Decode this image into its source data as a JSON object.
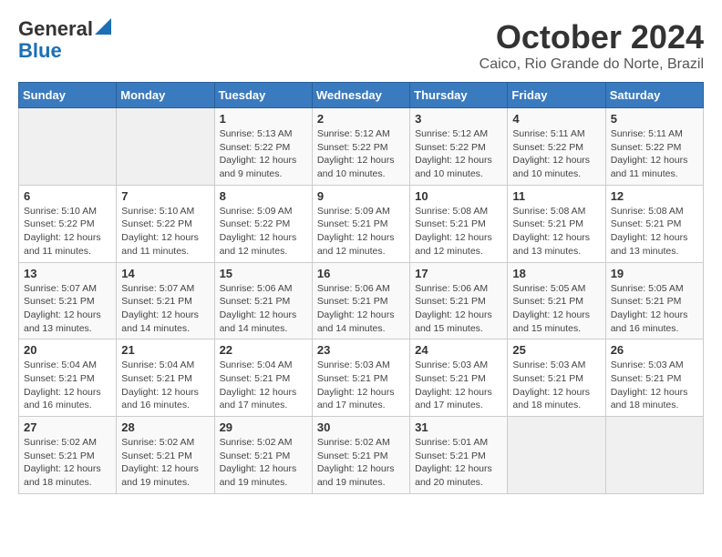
{
  "header": {
    "logo_line1": "General",
    "logo_line2": "Blue",
    "month": "October 2024",
    "location": "Caico, Rio Grande do Norte, Brazil"
  },
  "weekdays": [
    "Sunday",
    "Monday",
    "Tuesday",
    "Wednesday",
    "Thursday",
    "Friday",
    "Saturday"
  ],
  "weeks": [
    [
      {
        "day": null
      },
      {
        "day": null
      },
      {
        "day": "1",
        "sunrise": "5:13 AM",
        "sunset": "5:22 PM",
        "daylight": "12 hours and 9 minutes."
      },
      {
        "day": "2",
        "sunrise": "5:12 AM",
        "sunset": "5:22 PM",
        "daylight": "12 hours and 10 minutes."
      },
      {
        "day": "3",
        "sunrise": "5:12 AM",
        "sunset": "5:22 PM",
        "daylight": "12 hours and 10 minutes."
      },
      {
        "day": "4",
        "sunrise": "5:11 AM",
        "sunset": "5:22 PM",
        "daylight": "12 hours and 10 minutes."
      },
      {
        "day": "5",
        "sunrise": "5:11 AM",
        "sunset": "5:22 PM",
        "daylight": "12 hours and 11 minutes."
      }
    ],
    [
      {
        "day": "6",
        "sunrise": "5:10 AM",
        "sunset": "5:22 PM",
        "daylight": "12 hours and 11 minutes."
      },
      {
        "day": "7",
        "sunrise": "5:10 AM",
        "sunset": "5:22 PM",
        "daylight": "12 hours and 11 minutes."
      },
      {
        "day": "8",
        "sunrise": "5:09 AM",
        "sunset": "5:22 PM",
        "daylight": "12 hours and 12 minutes."
      },
      {
        "day": "9",
        "sunrise": "5:09 AM",
        "sunset": "5:21 PM",
        "daylight": "12 hours and 12 minutes."
      },
      {
        "day": "10",
        "sunrise": "5:08 AM",
        "sunset": "5:21 PM",
        "daylight": "12 hours and 12 minutes."
      },
      {
        "day": "11",
        "sunrise": "5:08 AM",
        "sunset": "5:21 PM",
        "daylight": "12 hours and 13 minutes."
      },
      {
        "day": "12",
        "sunrise": "5:08 AM",
        "sunset": "5:21 PM",
        "daylight": "12 hours and 13 minutes."
      }
    ],
    [
      {
        "day": "13",
        "sunrise": "5:07 AM",
        "sunset": "5:21 PM",
        "daylight": "12 hours and 13 minutes."
      },
      {
        "day": "14",
        "sunrise": "5:07 AM",
        "sunset": "5:21 PM",
        "daylight": "12 hours and 14 minutes."
      },
      {
        "day": "15",
        "sunrise": "5:06 AM",
        "sunset": "5:21 PM",
        "daylight": "12 hours and 14 minutes."
      },
      {
        "day": "16",
        "sunrise": "5:06 AM",
        "sunset": "5:21 PM",
        "daylight": "12 hours and 14 minutes."
      },
      {
        "day": "17",
        "sunrise": "5:06 AM",
        "sunset": "5:21 PM",
        "daylight": "12 hours and 15 minutes."
      },
      {
        "day": "18",
        "sunrise": "5:05 AM",
        "sunset": "5:21 PM",
        "daylight": "12 hours and 15 minutes."
      },
      {
        "day": "19",
        "sunrise": "5:05 AM",
        "sunset": "5:21 PM",
        "daylight": "12 hours and 16 minutes."
      }
    ],
    [
      {
        "day": "20",
        "sunrise": "5:04 AM",
        "sunset": "5:21 PM",
        "daylight": "12 hours and 16 minutes."
      },
      {
        "day": "21",
        "sunrise": "5:04 AM",
        "sunset": "5:21 PM",
        "daylight": "12 hours and 16 minutes."
      },
      {
        "day": "22",
        "sunrise": "5:04 AM",
        "sunset": "5:21 PM",
        "daylight": "12 hours and 17 minutes."
      },
      {
        "day": "23",
        "sunrise": "5:03 AM",
        "sunset": "5:21 PM",
        "daylight": "12 hours and 17 minutes."
      },
      {
        "day": "24",
        "sunrise": "5:03 AM",
        "sunset": "5:21 PM",
        "daylight": "12 hours and 17 minutes."
      },
      {
        "day": "25",
        "sunrise": "5:03 AM",
        "sunset": "5:21 PM",
        "daylight": "12 hours and 18 minutes."
      },
      {
        "day": "26",
        "sunrise": "5:03 AM",
        "sunset": "5:21 PM",
        "daylight": "12 hours and 18 minutes."
      }
    ],
    [
      {
        "day": "27",
        "sunrise": "5:02 AM",
        "sunset": "5:21 PM",
        "daylight": "12 hours and 18 minutes."
      },
      {
        "day": "28",
        "sunrise": "5:02 AM",
        "sunset": "5:21 PM",
        "daylight": "12 hours and 19 minutes."
      },
      {
        "day": "29",
        "sunrise": "5:02 AM",
        "sunset": "5:21 PM",
        "daylight": "12 hours and 19 minutes."
      },
      {
        "day": "30",
        "sunrise": "5:02 AM",
        "sunset": "5:21 PM",
        "daylight": "12 hours and 19 minutes."
      },
      {
        "day": "31",
        "sunrise": "5:01 AM",
        "sunset": "5:21 PM",
        "daylight": "12 hours and 20 minutes."
      },
      {
        "day": null
      },
      {
        "day": null
      }
    ]
  ]
}
